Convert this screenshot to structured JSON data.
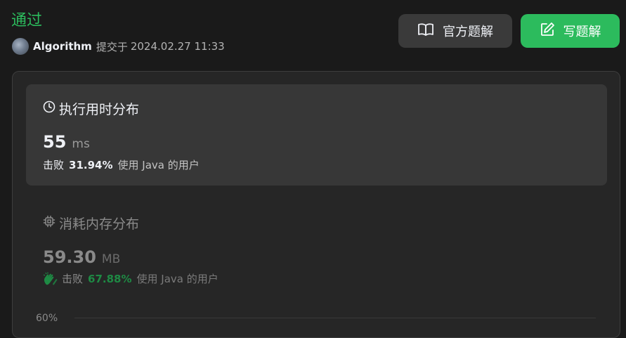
{
  "header": {
    "status": "通过",
    "username": "Algorithm",
    "submit_label": "提交于",
    "submit_time": "2024.02.27 11:33"
  },
  "actions": {
    "official_solution": "官方题解",
    "write_solution": "写题解"
  },
  "runtime": {
    "title": "执行用时分布",
    "value": "55",
    "unit": "ms",
    "beats_label": "击败",
    "beats_percent": "31.94%",
    "beats_suffix": "使用 Java 的用户"
  },
  "memory": {
    "title": "消耗内存分布",
    "value": "59.30",
    "unit": "MB",
    "beats_label": "击败",
    "beats_percent": "67.88%",
    "beats_suffix": "使用 Java 的用户"
  },
  "chart": {
    "y_tick": "60%"
  },
  "colors": {
    "accepted": "#2cbb5d",
    "beats_memory": "#1e8a44"
  },
  "icons": {
    "solution": "book-open-icon",
    "write": "edit-icon",
    "runtime": "clock-icon",
    "memory": "chip-icon",
    "beats_memory": "clapping-hands-icon"
  }
}
